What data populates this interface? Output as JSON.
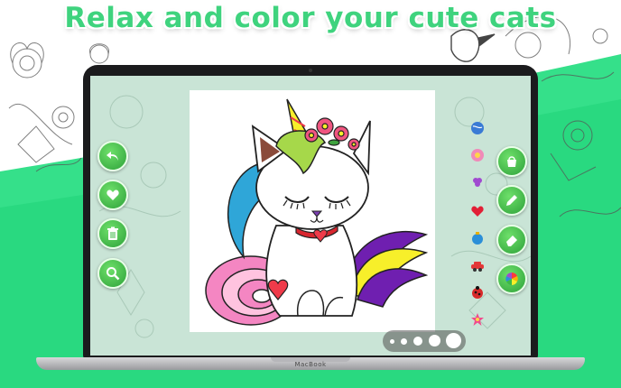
{
  "headline": "Relax and color your cute cats",
  "brand": "MacBook",
  "colors": {
    "accent": "#3fd37e",
    "button_green": "#3cb847",
    "heart_red": "#ef3b4a"
  },
  "left_tools": [
    {
      "name": "undo-button",
      "icon": "undo-arrow-icon"
    },
    {
      "name": "favorite-button",
      "icon": "heart-icon"
    },
    {
      "name": "delete-button",
      "icon": "trash-icon"
    },
    {
      "name": "zoom-button",
      "icon": "search-icon"
    }
  ],
  "right_tools": [
    {
      "name": "fill-bucket-button",
      "icon": "paint-bucket-icon"
    },
    {
      "name": "pencil-button",
      "icon": "pencil-icon"
    },
    {
      "name": "eraser-button",
      "icon": "eraser-icon"
    },
    {
      "name": "color-wheel-button",
      "icon": "color-wheel-icon"
    }
  ],
  "stickers": [
    "globe-sticker-icon",
    "flower-sticker-icon",
    "grape-sticker-icon",
    "heart-sticker-icon",
    "ornament-sticker-icon",
    "car-sticker-icon",
    "ladybug-sticker-icon",
    "star-sticker-icon"
  ],
  "brush_sizes": [
    "small",
    "medium-small",
    "medium",
    "large",
    "x-large"
  ]
}
